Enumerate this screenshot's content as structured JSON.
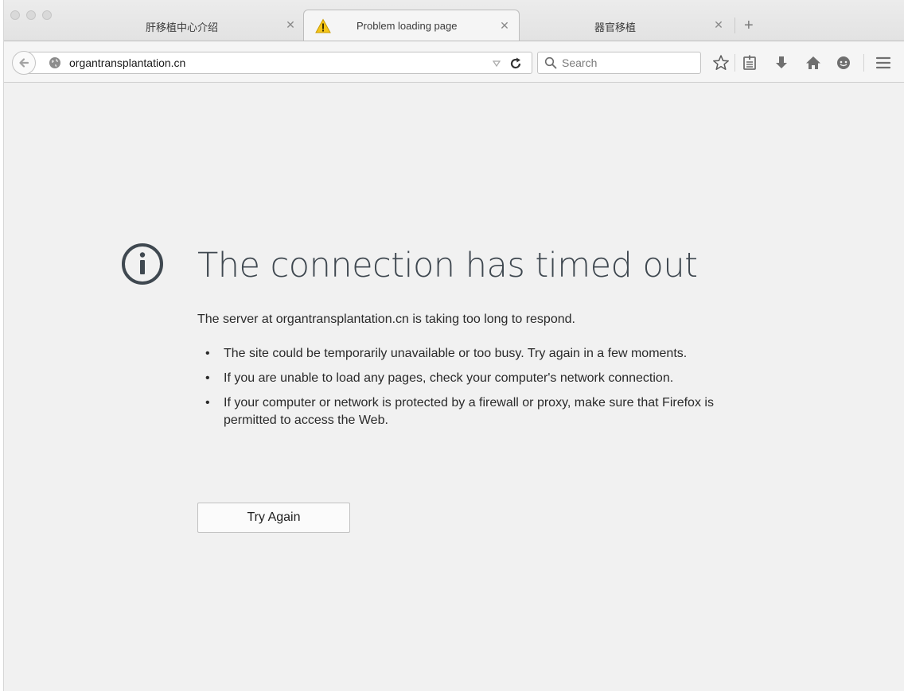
{
  "tabs": [
    {
      "title": "肝移植中心介绍",
      "selected": false
    },
    {
      "title": "Problem loading page",
      "selected": true
    },
    {
      "title": "器官移植",
      "selected": false
    }
  ],
  "tab_close_glyph": "✕",
  "new_tab_glyph": "+",
  "urlbar": {
    "value": "organtransplantation.cn"
  },
  "searchbar": {
    "placeholder": "Search"
  },
  "toolbar_icons": [
    "star-icon",
    "reading-list-icon",
    "download-icon",
    "home-icon",
    "chat-icon",
    "menu-icon"
  ],
  "error": {
    "title": "The connection has timed out",
    "description": "The server at organtransplantation.cn is taking too long to respond.",
    "bullets": [
      "The site could be temporarily unavailable or too busy. Try again in a few moments.",
      "If you are unable to load any pages, check your computer's network connection.",
      "If your computer or network is protected by a firewall or proxy, make sure that Firefox is permitted to access the Web."
    ],
    "button_label": "Try Again"
  },
  "colors": {
    "page_bg": "#f1f1f1",
    "title_text": "#3f4850",
    "icon_gray": "#8c8c8c",
    "warning_yellow": "#f5c518"
  }
}
